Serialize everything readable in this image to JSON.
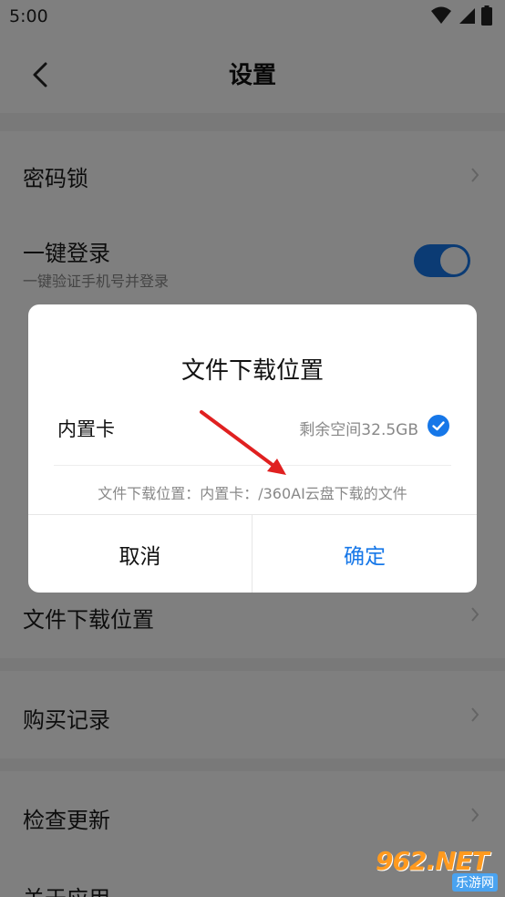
{
  "status_bar": {
    "time": "5:00"
  },
  "header": {
    "title": "设置"
  },
  "settings": {
    "password_lock": "密码锁",
    "one_key_login": {
      "label": "一键登录",
      "sub": "一键验证手机号并登录",
      "enabled": true
    },
    "download_location": "文件下载位置",
    "purchase_records": "购买记录",
    "check_update": "检查更新",
    "about_app": "关于应用"
  },
  "dialog": {
    "title": "文件下载位置",
    "storage_label": "内置卡",
    "free_space": "剩余空间32.5GB",
    "selected": true,
    "path_text": "文件下载位置：内置卡：/360AI云盘下载的文件",
    "cancel_label": "取消",
    "ok_label": "确定"
  },
  "watermark": {
    "brand": "962.NET",
    "sub": "乐游网"
  },
  "colors": {
    "accent": "#1677e8",
    "arrow": "#e02020",
    "overlay": "rgba(0,0,0,0.5)"
  }
}
